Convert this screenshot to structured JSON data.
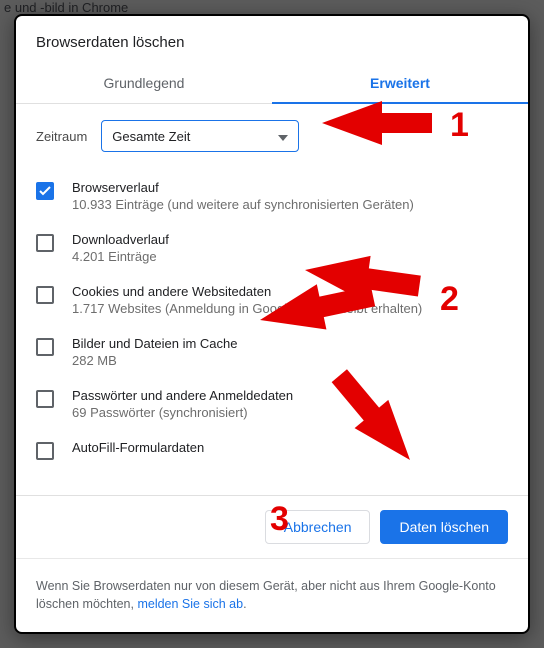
{
  "background_text": "e und -bild in Chrome",
  "dialog": {
    "title": "Browserdaten löschen",
    "tabs": {
      "basic": "Grundlegend",
      "advanced": "Erweitert"
    },
    "time": {
      "label": "Zeitraum",
      "value": "Gesamte Zeit"
    },
    "items": [
      {
        "checked": true,
        "label": "Browserverlauf",
        "sub": "10.933 Einträge (und weitere auf synchronisierten Geräten)"
      },
      {
        "checked": false,
        "label": "Downloadverlauf",
        "sub": "4.201 Einträge"
      },
      {
        "checked": false,
        "label": "Cookies und andere Websitedaten",
        "sub": "1.717 Websites (Anmeldung in Google-Konto bleibt erhalten)"
      },
      {
        "checked": false,
        "label": "Bilder und Dateien im Cache",
        "sub": "282 MB"
      },
      {
        "checked": false,
        "label": "Passwörter und andere Anmeldedaten",
        "sub": "69 Passwörter (synchronisiert)"
      },
      {
        "checked": false,
        "label": "AutoFill-Formulardaten",
        "sub": ""
      }
    ],
    "buttons": {
      "cancel": "Abbrechen",
      "confirm": "Daten löschen"
    },
    "note_pre": "Wenn Sie Browserdaten nur von diesem Gerät, aber nicht aus Ihrem Google-Konto löschen möchten, ",
    "note_link": "melden Sie sich ab",
    "note_post": "."
  },
  "annotations": {
    "n1": "1",
    "n2": "2",
    "n3": "3"
  }
}
